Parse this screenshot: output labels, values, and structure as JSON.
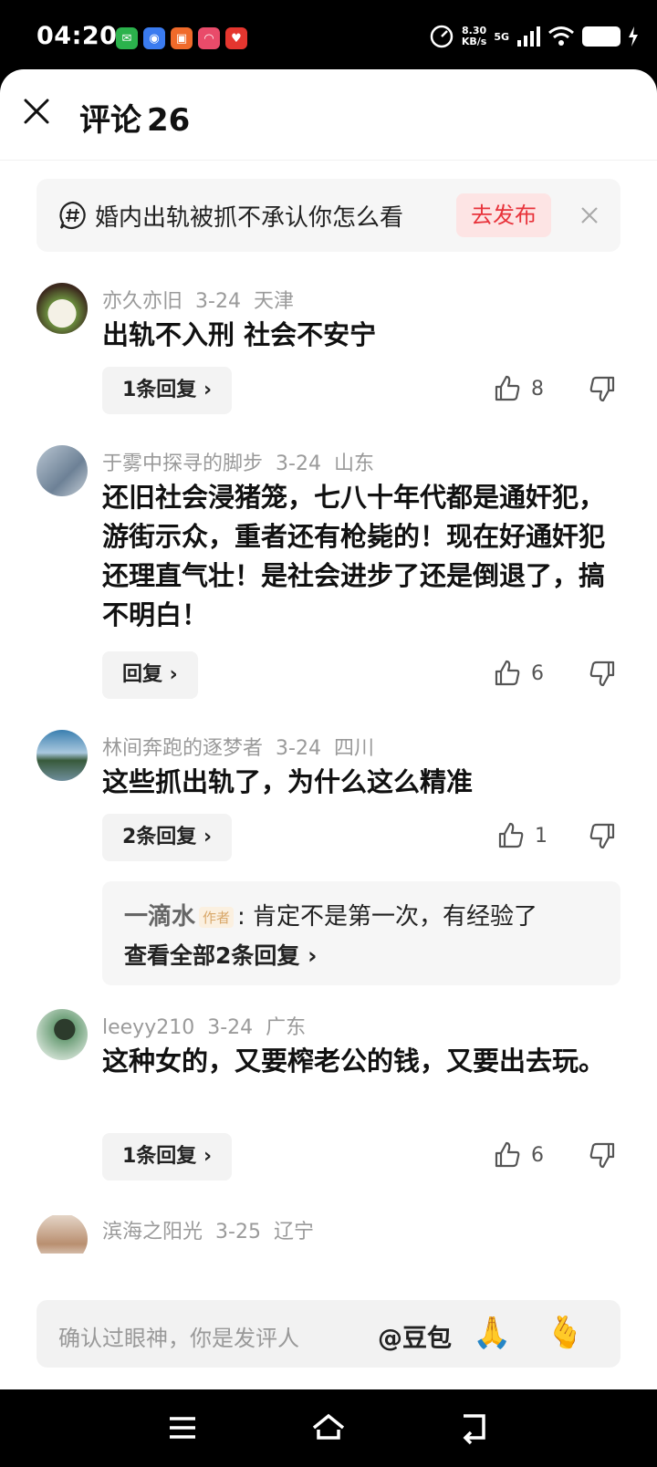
{
  "status_bar": {
    "time": "04:20",
    "speed_value": "8.30",
    "speed_unit": "KB/s",
    "network": "5G",
    "app_icon_colors": [
      "#2bb24c",
      "#3a7bf0",
      "#f06a2a",
      "#e94b6a",
      "#e5362f"
    ]
  },
  "header": {
    "title": "评论",
    "count": "26"
  },
  "topic_banner": {
    "text": "婚内出轨被抓不承认你怎么看",
    "publish_label": "去发布"
  },
  "comments": [
    {
      "author": "亦久亦旧",
      "date": "3-24",
      "location": "天津",
      "text": "出轨不入刑 社会不安宁",
      "reply_label": "1条回复 ›",
      "likes": "8",
      "avatar_color": "#6a8c3e"
    },
    {
      "author": "于雾中探寻的脚步",
      "date": "3-24",
      "location": "山东",
      "text": "还旧社会浸猪笼，七八十年代都是通奸犯，游街示众，重者还有枪毙的！现在好通奸犯还理直气壮！是社会进步了还是倒退了，搞不明白！",
      "reply_label": "回复 ›",
      "likes": "6",
      "avatar_color": "#8da2b8"
    },
    {
      "author": "林间奔跑的逐梦者",
      "date": "3-24",
      "location": "四川",
      "text": "这些抓出轨了，为什么这么精准",
      "reply_label": "2条回复 ›",
      "likes": "1",
      "avatar_color": "#2f6a8a",
      "sub_reply": {
        "author": "一滴水",
        "tag": "作者",
        "text": ": 肯定不是第一次，有经验了",
        "view_all": "查看全部2条回复 ›"
      }
    },
    {
      "author": "leeyy210",
      "date": "3-24",
      "location": "广东",
      "text": "这种女的，又要榨老公的钱，又要出去玩。",
      "reply_label": "1条回复 ›",
      "likes": "6",
      "avatar_color": "#3e6b4a"
    },
    {
      "author": "滨海之阳光",
      "date": "3-25",
      "location": "辽宁",
      "avatar_color": "#c9a58a"
    }
  ],
  "input_bar": {
    "placeholder": "确认过眼神，你是发评人",
    "mention": "@豆包",
    "emoji_1": "🙏",
    "emoji_2": "🫰"
  }
}
